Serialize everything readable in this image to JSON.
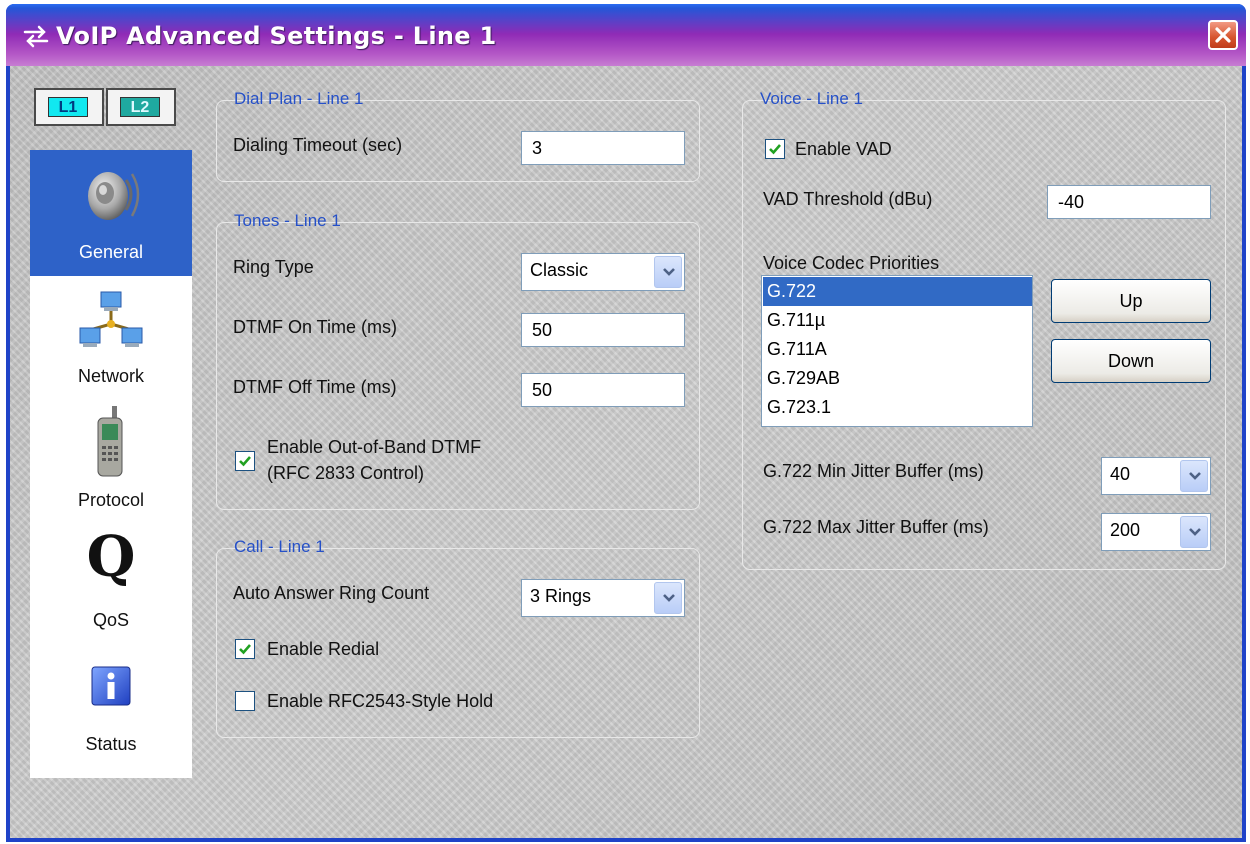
{
  "window": {
    "title": "VoIP Advanced Settings - Line 1",
    "close_icon": "close-icon"
  },
  "lines": [
    {
      "label": "L1",
      "selected": true
    },
    {
      "label": "L2",
      "selected": false
    }
  ],
  "nav": {
    "items": [
      {
        "label": "General",
        "icon": "speaker-icon",
        "active": true
      },
      {
        "label": "Network",
        "icon": "network-icon",
        "active": false
      },
      {
        "label": "Protocol",
        "icon": "phone-icon",
        "active": false
      },
      {
        "label": "QoS",
        "icon": "qos-icon",
        "active": false
      },
      {
        "label": "Status",
        "icon": "info-icon",
        "active": false
      }
    ]
  },
  "dial_plan": {
    "title": "Dial Plan - Line 1",
    "timeout_label": "Dialing Timeout (sec)",
    "timeout_value": "3"
  },
  "tones": {
    "title": "Tones - Line 1",
    "ring_type_label": "Ring Type",
    "ring_type_value": "Classic",
    "dtmf_on_label": "DTMF On Time (ms)",
    "dtmf_on_value": "50",
    "dtmf_off_label": "DTMF Off Time (ms)",
    "dtmf_off_value": "50",
    "oob_label_line1": "Enable Out-of-Band DTMF",
    "oob_label_line2": "(RFC 2833 Control)",
    "oob_checked": true
  },
  "call": {
    "title": "Call - Line 1",
    "auto_answer_label": "Auto Answer Ring Count",
    "auto_answer_value": "3 Rings",
    "redial_label": "Enable Redial",
    "redial_checked": true,
    "hold_label": "Enable RFC2543-Style Hold",
    "hold_checked": false
  },
  "voice": {
    "title": "Voice - Line 1",
    "vad_label": "Enable VAD",
    "vad_checked": true,
    "vad_threshold_label": "VAD Threshold (dBu)",
    "vad_threshold_value": "-40",
    "codec_label": "Voice Codec Priorities",
    "codecs": [
      "G.722",
      "G.711µ",
      "G.711A",
      "G.729AB",
      "G.723.1"
    ],
    "selected_codec": "G.722",
    "up_label": "Up",
    "down_label": "Down",
    "min_jitter_label": "G.722 Min Jitter Buffer (ms)",
    "min_jitter_value": "40",
    "max_jitter_label": "G.722 Max Jitter Buffer (ms)",
    "max_jitter_value": "200"
  },
  "colors": {
    "title_bar": "#9a35bd",
    "accent_blue": "#2e62c8",
    "group_title": "#2550c8",
    "selected_item": "#316ac5",
    "checkmark": "#21a121"
  }
}
